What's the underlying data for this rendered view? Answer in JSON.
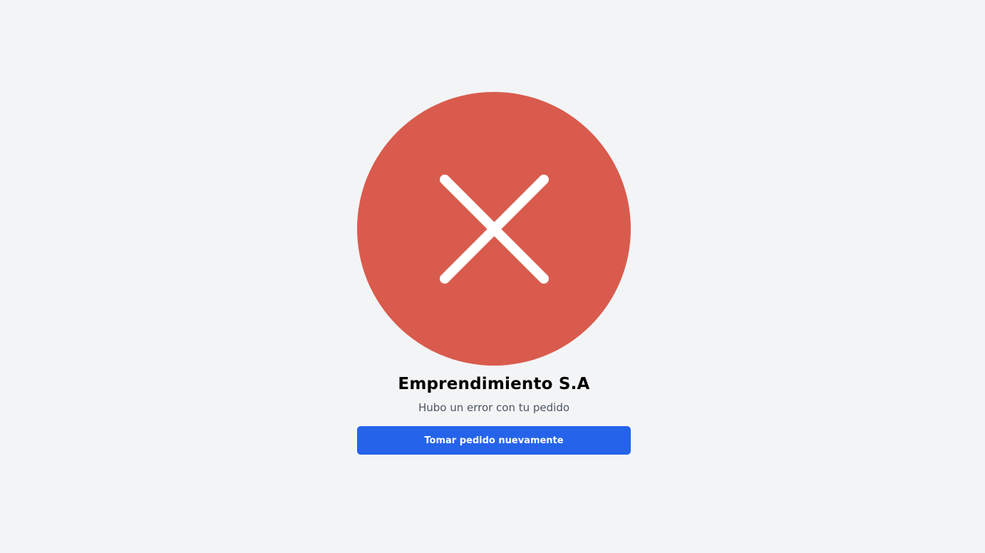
{
  "status": {
    "icon": "close-icon",
    "color": "#d95b4d"
  },
  "company": {
    "name": "Emprendimiento S.A"
  },
  "message": {
    "text": "Hubo un error con tu pedido"
  },
  "actions": {
    "retry_label": "Tomar pedido nuevamente",
    "retry_color": "#2563eb"
  }
}
